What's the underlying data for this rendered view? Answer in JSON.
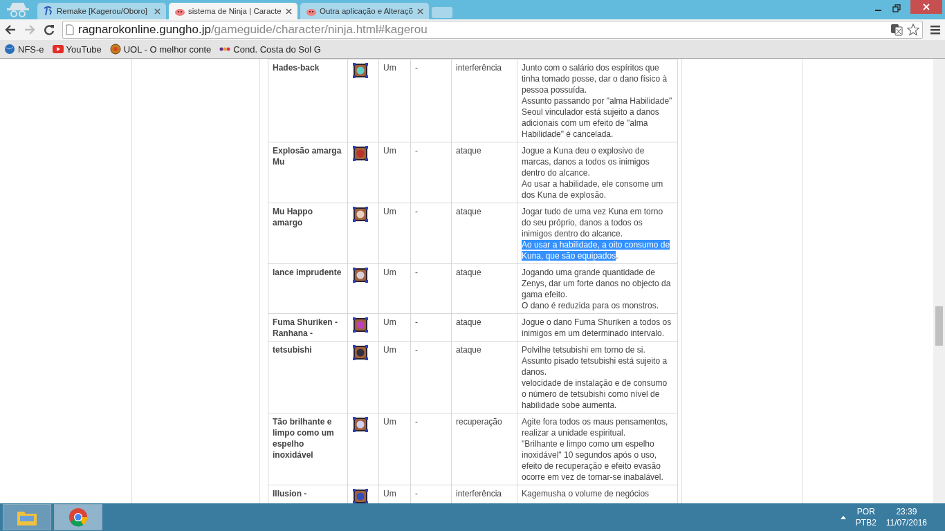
{
  "tabs": [
    {
      "title": "Remake [Kagerou/Oboro]",
      "selected": false,
      "kind": "swirl"
    },
    {
      "title": "sistema de Ninja | Caracte",
      "selected": true,
      "kind": "poring"
    },
    {
      "title": "Outra aplicação e Alteraçõ",
      "selected": false,
      "kind": "poring"
    }
  ],
  "address": {
    "host": "ragnarokonline.gungho.jp",
    "path": "/gameguide/character/ninja.html#kagerou"
  },
  "bookmarks": [
    {
      "label": "NFS-e",
      "kind": "globe"
    },
    {
      "label": "YouTube",
      "kind": "youtube"
    },
    {
      "label": "UOL - O melhor conte",
      "kind": "uol"
    },
    {
      "label": "Cond. Costa do Sol G",
      "kind": "olx"
    }
  ],
  "skills": [
    {
      "name": "Hades-back",
      "level": "Um",
      "col_4": "-",
      "type": "interferência",
      "description": [
        [
          {
            "text": "Junto com o salário dos espíritos que tinha tomado posse, dar o dano físico à pessoa possuída.",
            "selected": false
          }
        ],
        [
          {
            "text": "Assunto passando por \"alma Habilidade\" Seoul vinculador está sujeito a danos adicionais com um efeito de \"alma Habilidade\" é cancelada.",
            "selected": false
          }
        ]
      ]
    },
    {
      "name": "Explosão amarga Mu",
      "level": "Um",
      "col_4": "-",
      "type": "ataque",
      "description": [
        [
          {
            "text": "Jogue a Kuna deu o explosivo de marcas, danos a todos os inimigos dentro do alcance.",
            "selected": false
          }
        ],
        [
          {
            "text": "Ao usar a habilidade, ele consome um dos Kuna de explosão.",
            "selected": false
          }
        ]
      ]
    },
    {
      "name": "Mu Happo amargo",
      "level": "Um",
      "col_4": "-",
      "type": "ataque",
      "description": [
        [
          {
            "text": "Jogar tudo de uma vez Kuna em torno do seu próprio, danos a todos os inimigos dentro do alcance.",
            "selected": false
          }
        ],
        [
          {
            "text": "Ao usar a habilidade, a oito consumo de Kuna, que são equipados",
            "selected": true
          },
          {
            "text": ".",
            "selected": false
          }
        ]
      ]
    },
    {
      "name": "lance imprudente",
      "level": "Um",
      "col_4": "-",
      "type": "ataque",
      "description": [
        [
          {
            "text": "Jogando uma grande quantidade de Zenys, dar um forte danos no objecto da gama efeito.",
            "selected": false
          }
        ],
        [
          {
            "text": "O dano é reduzida para os monstros.",
            "selected": false
          }
        ]
      ]
    },
    {
      "name": "Fuma Shuriken - Ranhana -",
      "level": "Um",
      "col_4": "-",
      "type": "ataque",
      "description": [
        [
          {
            "text": "Jogue o dano Fuma Shuriken a todos os inimigos em um determinado intervalo.",
            "selected": false
          }
        ]
      ]
    },
    {
      "name": "tetsubishi",
      "level": "Um",
      "col_4": "-",
      "type": "ataque",
      "description": [
        [
          {
            "text": "Polvilhe tetsubishi em torno de si.",
            "selected": false
          }
        ],
        [
          {
            "text": "Assunto pisado tetsubishi está sujeito a danos.",
            "selected": false
          }
        ],
        [
          {
            "text": "velocidade de instalação e de consumo o número de tetsubishi como nível de habilidade sobe aumenta.",
            "selected": false
          }
        ]
      ]
    },
    {
      "name": "Tão brilhante e limpo como um espelho inoxidável",
      "level": "Um",
      "col_4": "-",
      "type": "recuperação",
      "description": [
        [
          {
            "text": "Agite fora todos os maus pensamentos, realizar a unidade espiritual.",
            "selected": false
          }
        ],
        [
          {
            "text": "\"Brilhante e limpo como um espelho inoxidável\" 10 segundos após o uso, efeito de recuperação e efeito evasão ocorre em vez de tornar-se inabalável.",
            "selected": false
          }
        ]
      ]
    },
    {
      "name": "Illusion -",
      "level": "Um",
      "col_4": "-",
      "type": "interferência",
      "description": [
        [
          {
            "text": "Kagemusha o volume de negócios",
            "selected": false
          }
        ]
      ]
    }
  ],
  "tray": {
    "language": "POR",
    "layout": "PTB2",
    "time": "23:39",
    "date": "11/07/2016"
  }
}
